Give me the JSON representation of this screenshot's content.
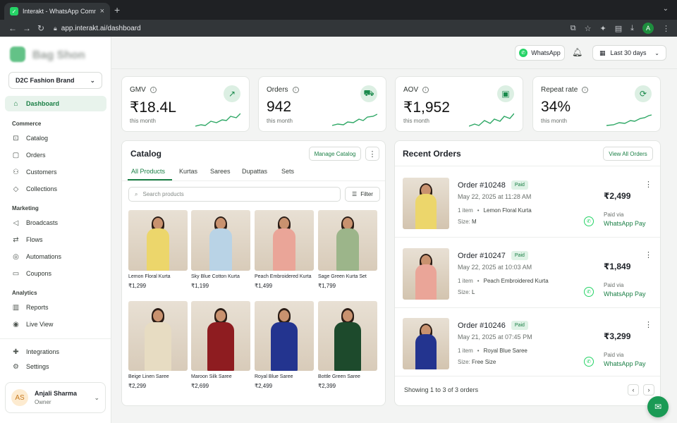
{
  "browser": {
    "tab_title": "Interakt - WhatsApp Commerce",
    "url": "app.interakt.ai/dashboard",
    "profile_initial": "A"
  },
  "sidebar": {
    "brand_name": "Bag Shon",
    "store": "D2C Fashion Brand",
    "items": [
      {
        "label": "Dashboard",
        "icon": "home-icon"
      },
      {
        "label": "Catalog",
        "icon": "bag-icon"
      },
      {
        "label": "Orders",
        "icon": "box-icon"
      },
      {
        "label": "Customers",
        "icon": "users-icon"
      },
      {
        "label": "Collections",
        "icon": "tag-icon"
      },
      {
        "label": "Broadcasts",
        "icon": "megaphone-icon"
      },
      {
        "label": "Flows",
        "icon": "flow-icon"
      },
      {
        "label": "Automations",
        "icon": "robot-icon"
      },
      {
        "label": "Coupons",
        "icon": "coupon-icon"
      },
      {
        "label": "Reports",
        "icon": "bar-chart-icon"
      },
      {
        "label": "Live View",
        "icon": "eye-icon"
      },
      {
        "label": "Integrations",
        "icon": "puzzle-icon"
      },
      {
        "label": "Settings",
        "icon": "gear-icon"
      }
    ],
    "sections": [
      "Commerce",
      "Marketing",
      "Analytics"
    ],
    "user": {
      "initials": "AS",
      "name": "Anjali Sharma",
      "role": "Owner"
    }
  },
  "header": {
    "whatsapp_label": "WhatsApp",
    "range_label": "Last 30 days"
  },
  "kpis": [
    {
      "label": "GMV",
      "value": "₹18.4L",
      "sub": "this month",
      "icon": "trend-up-icon"
    },
    {
      "label": "Orders",
      "value": "942",
      "sub": "this month",
      "icon": "cart-icon"
    },
    {
      "label": "AOV",
      "value": "₹1,952",
      "sub": "this month",
      "icon": "wallet-icon"
    },
    {
      "label": "Repeat rate",
      "value": "34%",
      "sub": "this month",
      "icon": "repeat-icon"
    }
  ],
  "catalog": {
    "title": "Catalog",
    "manage_label": "Manage Catalog",
    "tabs": [
      "All Products",
      "Kurtas",
      "Sarees",
      "Dupattas",
      "Sets"
    ],
    "search_placeholder": "Search products",
    "filter_label": "Filter",
    "products": [
      {
        "name": "Lemon Floral Kurta",
        "price": "₹1,299",
        "color": "#ecd66b"
      },
      {
        "name": "Sky Blue Cotton Kurta",
        "price": "₹1,199",
        "color": "#b9d3e6"
      },
      {
        "name": "Peach Embroidered Kurta",
        "price": "₹1,499",
        "color": "#eaa598"
      },
      {
        "name": "Sage Green Kurta Set",
        "price": "₹1,799",
        "color": "#9cb58a"
      },
      {
        "name": "Beige Linen Saree",
        "price": "₹2,299",
        "color": "#e7dcc2"
      },
      {
        "name": "Maroon Silk Saree",
        "price": "₹2,699",
        "color": "#8e1c20"
      },
      {
        "name": "Royal Blue Saree",
        "price": "₹2,499",
        "color": "#23348f"
      },
      {
        "name": "Bottle Green Saree",
        "price": "₹2,399",
        "color": "#1d4a2c"
      }
    ]
  },
  "orders": {
    "title": "Recent Orders",
    "view_all_label": "View All Orders",
    "list": [
      {
        "id": "Order #10248",
        "status": "Paid",
        "date": "May 22, 2025 at 11:28 AM",
        "qty": "1 item",
        "product": "Lemon Floral Kurta",
        "size_label": "Size:",
        "size": "M",
        "amount": "₹2,499",
        "paid_via": "Paid via",
        "method": "WhatsApp Pay",
        "color": "#ecd66b"
      },
      {
        "id": "Order #10247",
        "status": "Paid",
        "date": "May 22, 2025 at 10:03 AM",
        "qty": "1 item",
        "product": "Peach Embroidered Kurta",
        "size_label": "Size:",
        "size": "L",
        "amount": "₹1,849",
        "paid_via": "Paid via",
        "method": "WhatsApp Pay",
        "color": "#eaa598"
      },
      {
        "id": "Order #10246",
        "status": "Paid",
        "date": "May 21, 2025 at 07:45 PM",
        "qty": "1 item",
        "product": "Royal Blue Saree",
        "size_label": "Size:",
        "size": "Free Size",
        "amount": "₹3,299",
        "paid_via": "Paid via",
        "method": "WhatsApp Pay",
        "color": "#23348f"
      }
    ],
    "showing": "Showing 1 to 3 of 3 orders"
  },
  "colors": {
    "accent": "#1a7f45",
    "whatsapp": "#25d366"
  }
}
